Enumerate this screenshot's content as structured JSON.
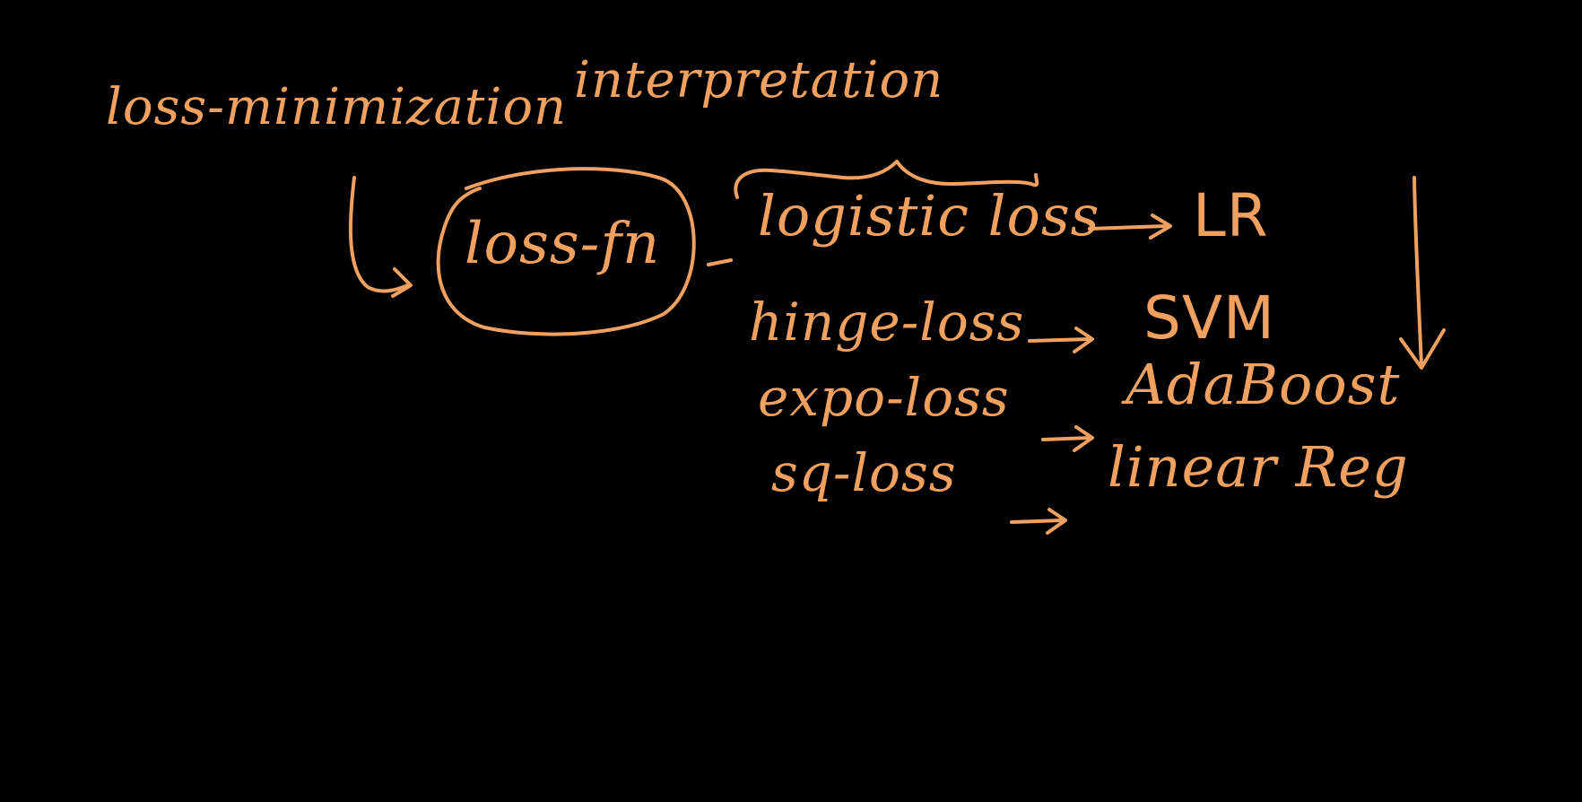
{
  "ink_color": "#f0a15f",
  "background": "#000000",
  "heading": {
    "left": "loss-minimization",
    "right": "interpretation"
  },
  "center_node": "loss-fn",
  "pairs": [
    {
      "loss": "logistic loss",
      "model": "LR"
    },
    {
      "loss": "hinge-loss",
      "model": "SVM"
    },
    {
      "loss": "expo-loss",
      "model": "AdaBoost"
    },
    {
      "loss": "sq-loss",
      "model": "linear Reg"
    }
  ]
}
